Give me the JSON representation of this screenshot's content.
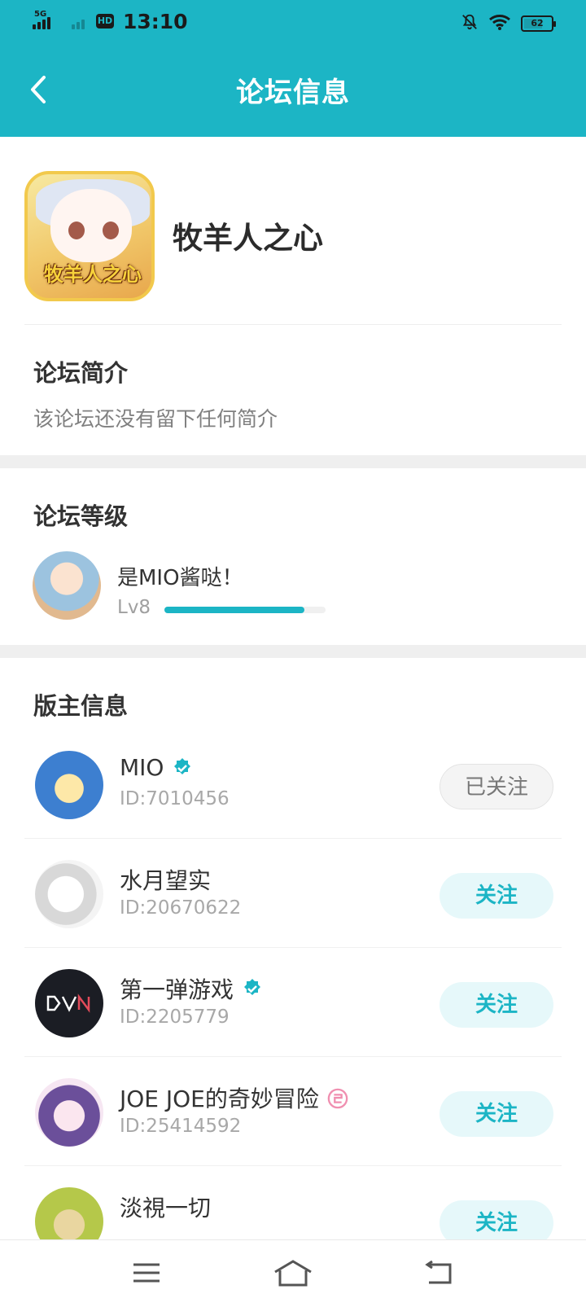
{
  "status_bar": {
    "network": "5G",
    "hd_label": "HD",
    "time": "13:10",
    "battery": "62"
  },
  "nav": {
    "title": "论坛信息"
  },
  "forum": {
    "name": "牧羊人之心",
    "icon_text": "牧羊人之心"
  },
  "intro": {
    "title": "论坛简介",
    "text": "该论坛还没有留下任何简介"
  },
  "level": {
    "title": "论坛等级",
    "user_name": "是MIO酱哒！",
    "level_label": "Lv8",
    "progress": 0.87
  },
  "moderators": {
    "title": "版主信息",
    "items": [
      {
        "name": "MIO",
        "id": "ID:7010456",
        "verified": true,
        "button": "已关注",
        "following": true
      },
      {
        "name": "水月望实",
        "id": "ID:20670622",
        "verified": false,
        "button": "关注",
        "following": false
      },
      {
        "name": "第一弹游戏",
        "id": "ID:2205779",
        "verified": true,
        "button": "关注",
        "following": false
      },
      {
        "name": "JOE JOE的奇妙冒险",
        "id": "ID:25414592",
        "verified": false,
        "button": "关注",
        "following": false
      },
      {
        "name": "淡視一切",
        "id": "",
        "verified": false,
        "button": "关注",
        "following": false
      }
    ]
  },
  "colors": {
    "accent": "#1cb5c5",
    "follow_bg": "#e6f8fa"
  }
}
